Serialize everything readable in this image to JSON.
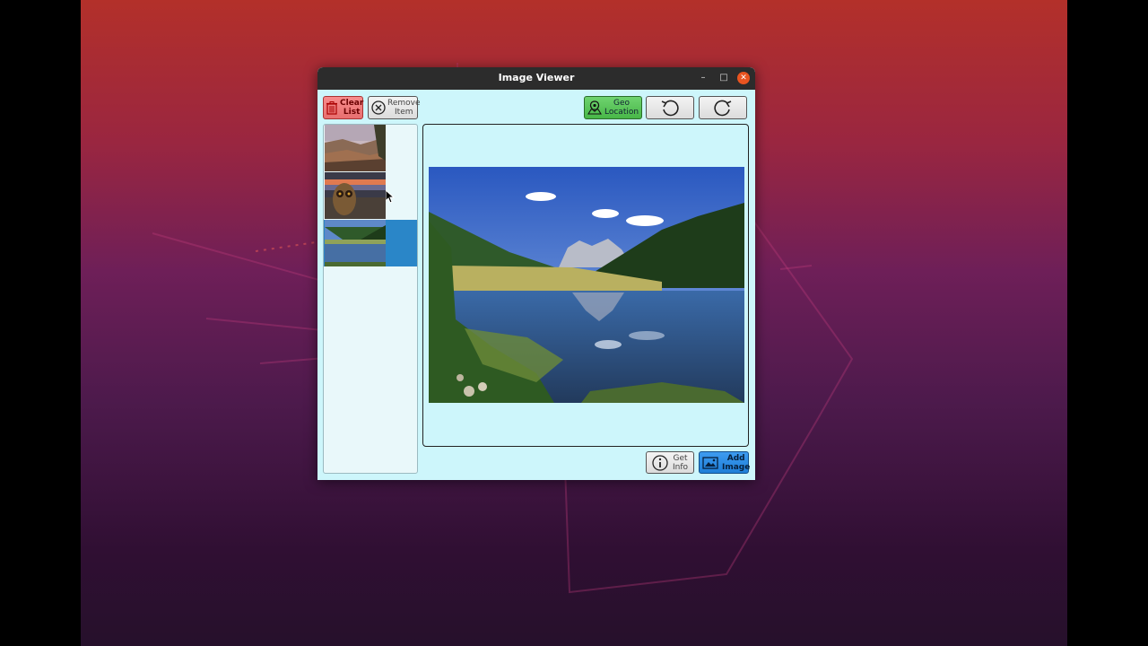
{
  "window": {
    "title": "Image Viewer"
  },
  "toolbar": {
    "clear_label_1": "Clear",
    "clear_label_2": "List",
    "remove_label_1": "Remove",
    "remove_label_2": "Item",
    "geo_label_1": "Geo",
    "geo_label_2": "Location"
  },
  "bottom": {
    "info_label_1": "Get",
    "info_label_2": "Info",
    "add_label_1": "Add",
    "add_label_2": "Image"
  },
  "thumbnails": [
    {
      "subject": "canyon landscape",
      "selected": false
    },
    {
      "subject": "owl at sunset",
      "selected": false
    },
    {
      "subject": "mountain lake",
      "selected": true
    }
  ],
  "colors": {
    "window_bg": "#cdf6fb",
    "clear_button": "#e86f6f",
    "geo_button": "#48b748",
    "add_button": "#1f7fd8",
    "selection": "#2a86c8",
    "close_button": "#e95420"
  },
  "icons": [
    "trash-icon",
    "remove-circle-icon",
    "map-pin-icon",
    "rotate-left-icon",
    "rotate-right-icon",
    "info-icon",
    "add-image-icon"
  ]
}
